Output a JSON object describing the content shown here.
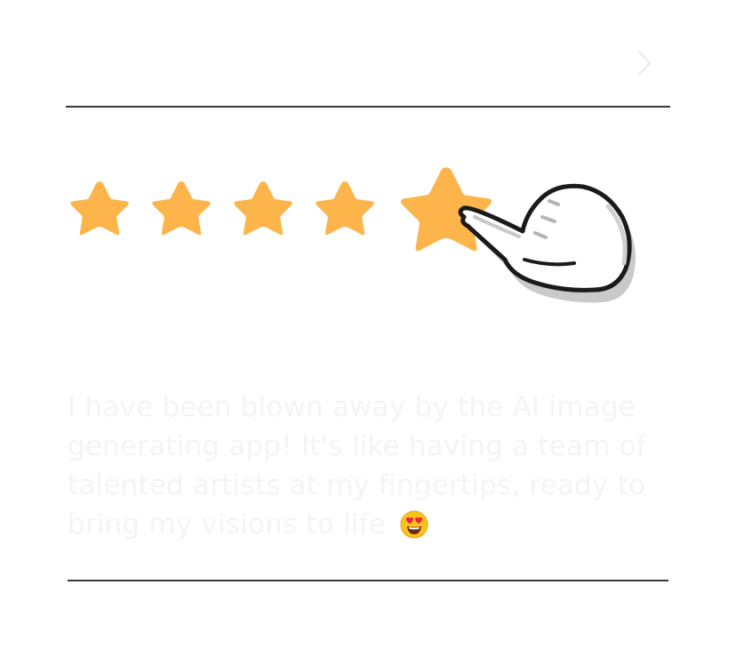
{
  "header": {
    "next_icon": "chevron-right-icon"
  },
  "rating": {
    "value": 5,
    "max": 5,
    "star_color": "#FDB44B",
    "pointer_icon": "pointing-hand-icon"
  },
  "review": {
    "text": "I have been blown away by the AI image generating app! It's like having a team of talented artists at my fingertips, ready to bring my visions to life",
    "emoji": "smiling-face-with-heart-eyes-emoji"
  },
  "colors": {
    "divider": "#3A3A3A",
    "review_text": "#F4F4F4",
    "background": "#FFFFFF"
  }
}
